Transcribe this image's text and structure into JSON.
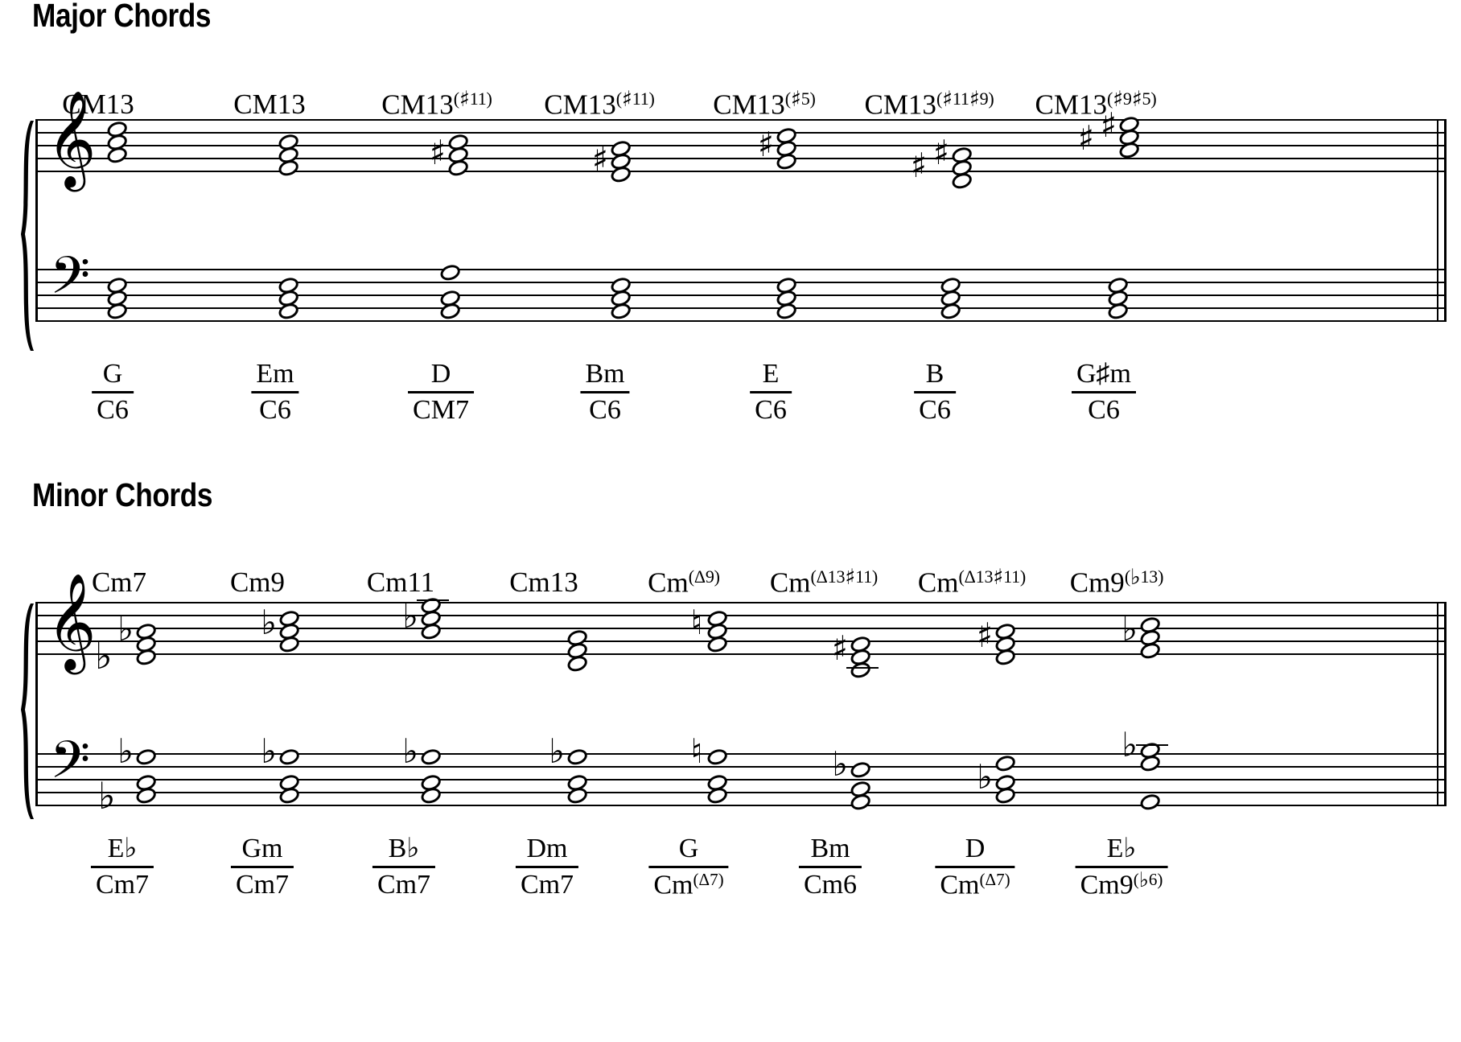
{
  "document": {
    "kind": "music-notation-sheet",
    "sections": [
      {
        "id": "major",
        "heading": "Major Chords",
        "chords": [
          {
            "root": "CM13",
            "ext": "",
            "upper": "G",
            "lower": "C6"
          },
          {
            "root": "CM13",
            "ext": "",
            "upper": "Em",
            "lower": "C6"
          },
          {
            "root": "CM13",
            "ext": "(♯11)",
            "upper": "D",
            "lower": "CM7"
          },
          {
            "root": "CM13",
            "ext": "(♯11)",
            "upper": "Bm",
            "lower": "C6"
          },
          {
            "root": "CM13",
            "ext": "(♯5)",
            "upper": "E",
            "lower": "C6"
          },
          {
            "root": "CM13",
            "ext": "(♯11♯9)",
            "upper": "B",
            "lower": "C6"
          },
          {
            "root": "CM13",
            "ext": "(♯9♯5)",
            "upper": "G♯m",
            "lower": "C6"
          }
        ]
      },
      {
        "id": "minor",
        "heading": "Minor Chords",
        "chords": [
          {
            "root": "Cm7",
            "ext": "",
            "upper": "E♭",
            "lower": "Cm7"
          },
          {
            "root": "Cm9",
            "ext": "",
            "upper": "Gm",
            "lower": "Cm7"
          },
          {
            "root": "Cm11",
            "ext": "",
            "upper": "B♭",
            "lower": "Cm7"
          },
          {
            "root": "Cm13",
            "ext": "",
            "upper": "Dm",
            "lower": "Cm7"
          },
          {
            "root": "Cm",
            "ext": "(Δ9)",
            "upper": "G",
            "lower": "Cm",
            "lower_ext": "(Δ7)"
          },
          {
            "root": "Cm",
            "ext": "(Δ13♯11)",
            "upper": "Bm",
            "lower": "Cm6",
            "lower_ext": ""
          },
          {
            "root": "Cm",
            "ext": "(Δ13♯11)",
            "upper": "D",
            "lower": "Cm",
            "lower_ext": "(Δ7)"
          },
          {
            "root": "Cm9",
            "ext": "(♭13)",
            "upper": "E♭",
            "lower": "Cm9",
            "lower_ext": "(♭6)"
          }
        ]
      }
    ],
    "glyphs": {
      "treble_clef": "𝄞",
      "bass_clef": "𝄢",
      "sharp": "♯",
      "flat": "♭",
      "natural": "♮",
      "triangle": "Δ"
    }
  },
  "colors": {
    "ink": "#000000",
    "paper": "#ffffff"
  }
}
